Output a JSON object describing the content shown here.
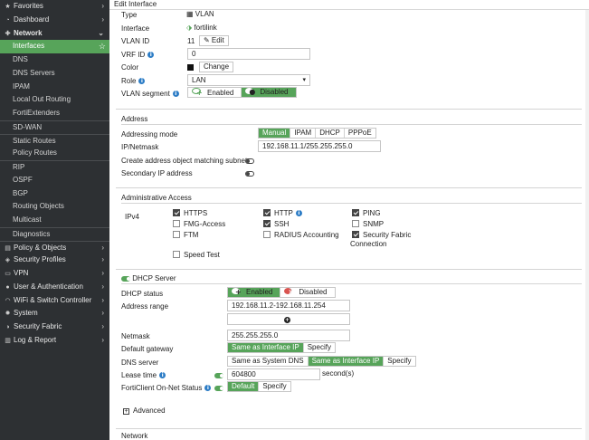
{
  "sidebar": {
    "items": [
      {
        "label": "Favorites",
        "icon": "star-icon",
        "glyph": "★",
        "chev": "›",
        "level": 0
      },
      {
        "label": "Dashboard",
        "icon": "dashboard-icon",
        "glyph": "◔",
        "chev": "›",
        "level": 0
      },
      {
        "label": "Network",
        "icon": "network-icon",
        "glyph": "✚",
        "chev": "⌄",
        "level": 0,
        "bold": true
      },
      {
        "label": "Interfaces",
        "level": 1,
        "active": true,
        "star": "☆"
      },
      {
        "label": "DNS",
        "level": 1
      },
      {
        "label": "DNS Servers",
        "level": 1
      },
      {
        "label": "IPAM",
        "level": 1
      },
      {
        "label": "Local Out Routing",
        "level": 1
      },
      {
        "label": "FortiExtenders",
        "level": 1
      },
      {
        "label": "SD-WAN",
        "level": 1,
        "sep": true
      },
      {
        "label": "Static Routes",
        "level": 1,
        "sep": true
      },
      {
        "label": "Policy Routes",
        "level": 1
      },
      {
        "label": "RIP",
        "level": 1,
        "sep": true
      },
      {
        "label": "OSPF",
        "level": 1
      },
      {
        "label": "BGP",
        "level": 1
      },
      {
        "label": "Routing Objects",
        "level": 1
      },
      {
        "label": "Multicast",
        "level": 1
      },
      {
        "label": "Diagnostics",
        "level": 1,
        "sep": true
      },
      {
        "label": "Policy & Objects",
        "icon": "policy-icon",
        "glyph": "▤",
        "chev": "›",
        "level": 0,
        "sep": true
      },
      {
        "label": "Security Profiles",
        "icon": "shield-icon",
        "glyph": "◈",
        "chev": "›",
        "level": 0
      },
      {
        "label": "VPN",
        "icon": "vpn-icon",
        "glyph": "▭",
        "chev": "›",
        "level": 0
      },
      {
        "label": "User & Authentication",
        "icon": "user-icon",
        "glyph": "●",
        "chev": "›",
        "level": 0
      },
      {
        "label": "WiFi & Switch Controller",
        "icon": "wifi-icon",
        "glyph": "◠",
        "chev": "›",
        "level": 0
      },
      {
        "label": "System",
        "icon": "gear-icon",
        "glyph": "✹",
        "chev": "›",
        "level": 0
      },
      {
        "label": "Security Fabric",
        "icon": "fabric-icon",
        "glyph": "◑",
        "chev": "›",
        "level": 0
      },
      {
        "label": "Log & Report",
        "icon": "log-icon",
        "glyph": "▥",
        "chev": "›",
        "level": 0
      }
    ]
  },
  "page": {
    "title": "Edit Interface"
  },
  "general": {
    "type_label": "Type",
    "type_value": "VLAN",
    "type_icon": "▦",
    "interface_label": "Interface",
    "interface_value": "fortilink",
    "interface_icon": "⬗",
    "vlan_id_label": "VLAN ID",
    "vlan_id_value": "11",
    "edit_label": "✎ Edit",
    "vrf_id_label": "VRF ID",
    "vrf_id_value": "0",
    "color_label": "Color",
    "color_change_label": "Change",
    "role_label": "Role",
    "role_value": "LAN",
    "role_caret": "▾",
    "vlan_segment_label": "VLAN segment",
    "vlan_segment_enabled": "Enabled",
    "vlan_segment_disabled": "Disabled"
  },
  "address": {
    "section_title": "Address",
    "mode_label": "Addressing mode",
    "modes": [
      "Manual",
      "IPAM",
      "DHCP",
      "PPPoE"
    ],
    "ip_label": "IP/Netmask",
    "ip_value": "192.168.11.1/255.255.255.0",
    "create_object_label": "Create address object matching subnet",
    "secondary_ip_label": "Secondary IP address"
  },
  "admin_access": {
    "section_title": "Administrative Access",
    "ipv4_label": "IPv4",
    "https": "HTTPS",
    "http": "HTTP",
    "ping": "PING",
    "fmg": "FMG-Access",
    "ssh": "SSH",
    "snmp": "SNMP",
    "ftm": "FTM",
    "radius": "RADIUS Accounting",
    "fabric_line1": "Security Fabric",
    "fabric_line2": "Connection",
    "speed_test": "Speed Test"
  },
  "dhcp": {
    "section_title": "DHCP Server",
    "status_label": "DHCP status",
    "status_enabled": "Enabled",
    "status_disabled": "Disabled",
    "range_label": "Address range",
    "range_value": "192.168.11.2-192.168.11.254",
    "netmask_label": "Netmask",
    "netmask_value": "255.255.255.0",
    "gateway_label": "Default gateway",
    "gateway_opt1": "Same as Interface IP",
    "gateway_opt2": "Specify",
    "dns_label": "DNS server",
    "dns_opt1": "Same as System DNS",
    "dns_opt2": "Same as Interface IP",
    "dns_opt3": "Specify",
    "lease_label": "Lease time",
    "lease_value": "604800",
    "lease_unit": "second(s)",
    "forticlient_label": "FortiClient On-Net Status",
    "forticlient_opt1": "Default",
    "forticlient_opt2": "Specify",
    "advanced_label": "Advanced"
  },
  "network_section": {
    "title": "Network"
  },
  "colors": {
    "accent": "#57a45a",
    "sidebar_bg": "#2d3033",
    "info_blue": "#2d7dc6"
  }
}
